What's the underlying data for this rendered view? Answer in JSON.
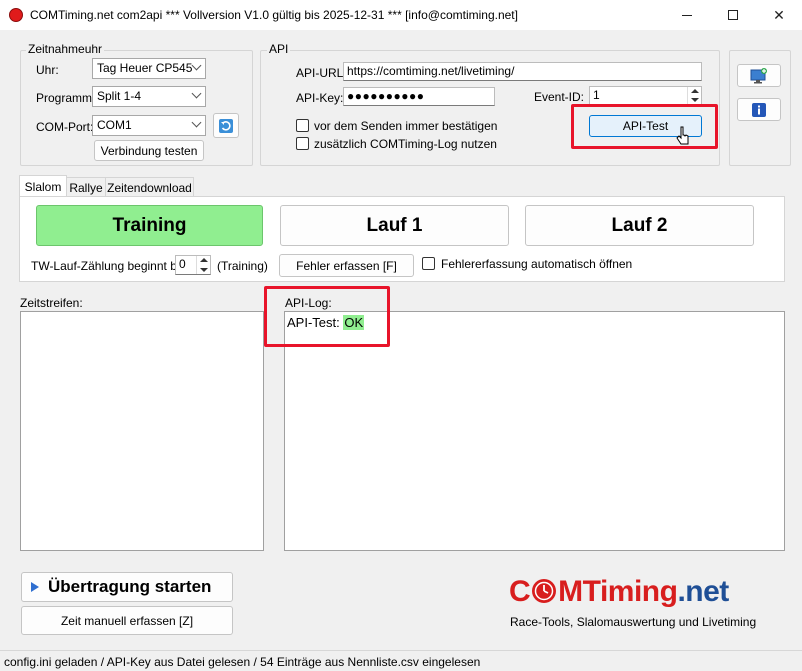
{
  "window": {
    "title": "COMTiming.net com2api *** Vollversion V1.0 gültig bis 2025-12-31 *** [info@comtiming.net]"
  },
  "zeitnahmeuhr": {
    "legend": "Zeitnahmeuhr",
    "uhr_label": "Uhr:",
    "uhr_value": "Tag Heuer CP545",
    "programm_label": "Programm:",
    "programm_value": "Split 1-4",
    "comport_label": "COM-Port:",
    "comport_value": "COM1",
    "test_button": "Verbindung testen"
  },
  "api": {
    "legend": "API",
    "url_label": "API-URL:",
    "url_value": "https://comtiming.net/livetiming/",
    "key_label": "API-Key:",
    "key_value": "●●●●●●●●●●",
    "event_label": "Event-ID:",
    "event_value": "1",
    "confirm_label": "vor dem Senden immer bestätigen",
    "log_label": "zusätzlich COMTiming-Log nutzen",
    "test_button": "API-Test"
  },
  "tabs": [
    {
      "label": "Slalom"
    },
    {
      "label": "Rallye"
    },
    {
      "label": "Zeitendownload"
    }
  ],
  "slalom": {
    "training": "Training",
    "lauf1": "Lauf 1",
    "lauf2": "Lauf 2",
    "tw_label": "TW-Lauf-Zählung beginnt bei:",
    "tw_value": "0",
    "tw_suffix": "(Training)",
    "fehler_button": "Fehler erfassen [F]",
    "fehler_auto_label": "Fehlererfassung automatisch öffnen"
  },
  "zeitstreifen": {
    "label": "Zeitstreifen:"
  },
  "apilog": {
    "label": "API-Log:",
    "entry_prefix": "API-Test:",
    "entry_status": "OK"
  },
  "actions": {
    "start": "Übertragung starten",
    "manual": "Zeit manuell erfassen [Z]"
  },
  "logo": {
    "brand_left": "C",
    "brand_mid": "MTiming",
    "brand_right": ".net",
    "tagline": "Race-Tools, Slalomauswertung und Livetiming"
  },
  "status": {
    "text": "config.ini geladen / API-Key aus Datei gelesen / 54 Einträge aus Nennliste.csv eingelesen"
  },
  "colors": {
    "highlight": "#e8142a",
    "training_green": "#90ee90",
    "ok_green": "#90ee90",
    "brand_red": "#d81e1e",
    "brand_blue": "#1f4f96"
  },
  "icons": [
    "app-record-icon",
    "monitor-add-icon",
    "info-icon",
    "refresh-icon",
    "play-arrow-icon",
    "mouse-cursor-icon"
  ]
}
